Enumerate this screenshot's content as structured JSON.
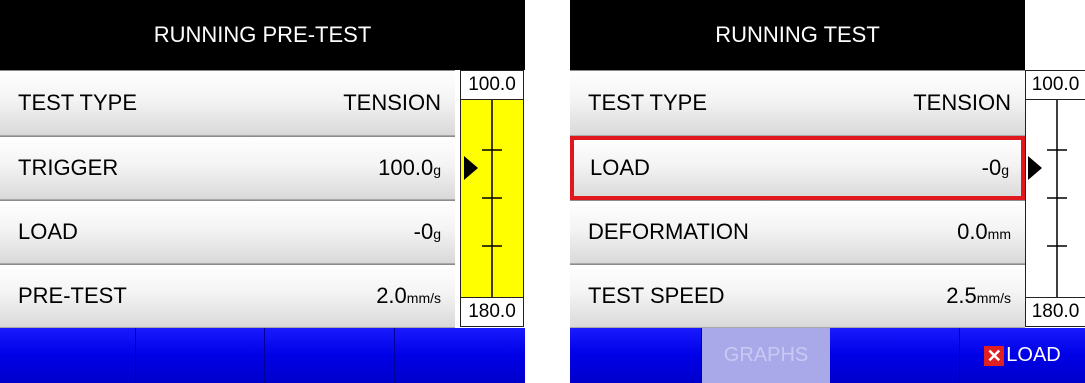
{
  "left_panel": {
    "title": "RUNNING PRE-TEST",
    "rows": [
      {
        "label": "TEST TYPE",
        "value": "TENSION",
        "unit": ""
      },
      {
        "label": "TRIGGER",
        "value": "100.0",
        "unit": "g"
      },
      {
        "label": "LOAD",
        "value": "-0",
        "unit": "g"
      },
      {
        "label": "PRE-TEST",
        "value": "2.0",
        "unit": "mm/s"
      }
    ],
    "gauge": {
      "top": "100.0",
      "bottom": "180.0",
      "fill_color": "#ffff00"
    },
    "buttons": [
      "",
      "",
      "",
      ""
    ]
  },
  "right_panel": {
    "title": "RUNNING TEST",
    "rows": [
      {
        "label": "TEST TYPE",
        "value": "TENSION",
        "unit": ""
      },
      {
        "label": "LOAD",
        "value": "-0",
        "unit": "g"
      },
      {
        "label": "DEFORMATION",
        "value": "0.0",
        "unit": "mm"
      },
      {
        "label": "TEST SPEED",
        "value": "2.5",
        "unit": "mm/s"
      }
    ],
    "gauge": {
      "top": "100.0",
      "bottom": "180.0",
      "fill_color": "#ffffff"
    },
    "buttons": [
      "",
      "",
      "GRAPHS",
      "",
      "LOAD"
    ]
  },
  "colors": {
    "title_bg": "#000000",
    "button_blue": "#0000e6",
    "highlight": "#e0171c",
    "gauge_yellow": "#ffff00"
  }
}
